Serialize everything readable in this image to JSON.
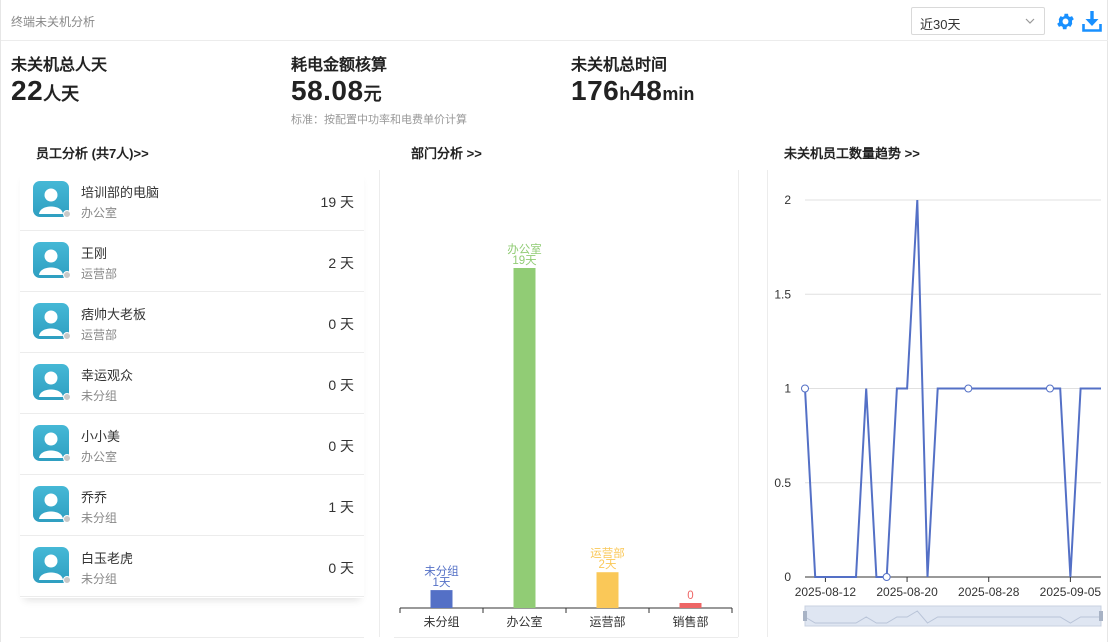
{
  "header": {
    "title": "终端未关机分析",
    "range_select": "近30天",
    "icons": {
      "settings": "gear-icon",
      "download": "download-icon"
    }
  },
  "stats": {
    "total_days": {
      "label": "未关机总人天",
      "value": "22",
      "unit": "人天"
    },
    "power_cost": {
      "label": "耗电金额核算",
      "value": "58.08",
      "unit": "元",
      "note": "标准：按配置中功率和电费单价计算"
    },
    "total_time": {
      "label": "未关机总时间",
      "hours": "176",
      "h_unit": "h",
      "minutes": "48",
      "m_unit": "min"
    }
  },
  "employee_section": {
    "title": "员工分析 (共7人)>>",
    "employees": [
      {
        "name": "培训部的电脑",
        "dept": "办公室",
        "days": "19 天"
      },
      {
        "name": "王刚",
        "dept": "运营部",
        "days": "2 天"
      },
      {
        "name": "痞帅大老板",
        "dept": "运营部",
        "days": "0 天"
      },
      {
        "name": "幸运观众",
        "dept": "未分组",
        "days": "0 天"
      },
      {
        "name": "小小美",
        "dept": "办公室",
        "days": "0 天"
      },
      {
        "name": "乔乔",
        "dept": "未分组",
        "days": "1 天"
      },
      {
        "name": "白玉老虎",
        "dept": "未分组",
        "days": "0 天"
      }
    ]
  },
  "dept_section": {
    "title": "部门分析 >>"
  },
  "trend_section": {
    "title": "未关机员工数量趋势 >>"
  },
  "colors": {
    "accent": "#1890ff",
    "bar_unassigned": "#5470c6",
    "bar_office": "#91cc75",
    "bar_ops": "#fac858",
    "bar_sales": "#ee6666",
    "line": "#5470c6"
  },
  "chart_data": [
    {
      "type": "bar",
      "categories": [
        "未分组",
        "办公室",
        "运营部",
        "销售部"
      ],
      "values": [
        1,
        19,
        2,
        0
      ],
      "data_labels": [
        [
          "未分组",
          "1天"
        ],
        [
          "办公室",
          "19天"
        ],
        [
          "运营部",
          "2天"
        ],
        [
          "0"
        ]
      ],
      "ylim": [
        0,
        19
      ]
    },
    {
      "type": "line",
      "x": [
        "2025-08-10",
        "2025-08-11",
        "2025-08-12",
        "2025-08-13",
        "2025-08-14",
        "2025-08-15",
        "2025-08-16",
        "2025-08-17",
        "2025-08-18",
        "2025-08-19",
        "2025-08-20",
        "2025-08-21",
        "2025-08-22",
        "2025-08-23",
        "2025-08-24",
        "2025-08-25",
        "2025-08-26",
        "2025-08-27",
        "2025-08-28",
        "2025-08-29",
        "2025-08-30",
        "2025-08-31",
        "2025-09-01",
        "2025-09-02",
        "2025-09-03",
        "2025-09-04",
        "2025-09-05",
        "2025-09-06",
        "2025-09-07",
        "2025-09-08"
      ],
      "values": [
        1,
        0,
        0,
        0,
        0,
        0,
        1,
        0,
        0,
        1,
        1,
        2,
        0,
        1,
        1,
        1,
        1,
        1,
        1,
        1,
        1,
        1,
        1,
        1,
        1,
        1,
        0,
        1,
        1,
        1
      ],
      "markers_at": [
        0,
        8,
        16,
        24
      ],
      "x_ticks": [
        "2025-08-12",
        "2025-08-20",
        "2025-08-28",
        "2025-09-05"
      ],
      "y_ticks": [
        "0",
        "0.5",
        "1",
        "1.5",
        "2"
      ],
      "ylim": [
        0,
        2
      ],
      "grid": true
    }
  ]
}
